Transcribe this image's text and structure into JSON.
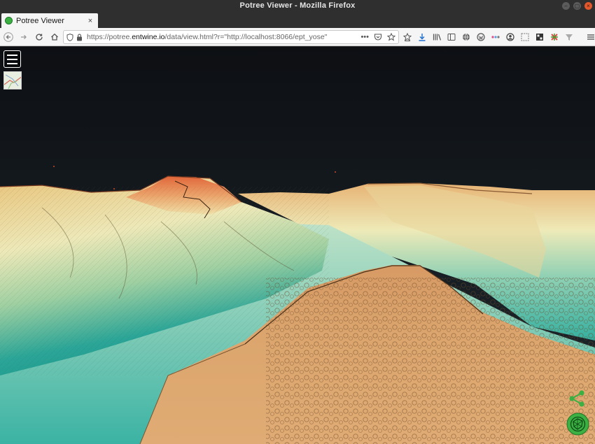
{
  "window": {
    "title": "Potree Viewer - Mozilla Firefox"
  },
  "tabs": [
    {
      "label": "Potree Viewer",
      "close_glyph": "×"
    }
  ],
  "new_tab_glyph": "+",
  "navigation": {
    "url_prefix": "https://potree.",
    "url_domain": "entwine.io",
    "url_suffix": "/data/view.html?r=\"http://localhost:8066/ept_yose\"",
    "url_more_glyph": "•••"
  },
  "icons": {
    "back": "back-arrow-icon",
    "forward": "forward-arrow-icon",
    "reload": "reload-icon",
    "home": "home-icon",
    "shield": "tracking-shield-icon",
    "lock": "lock-icon",
    "pocket": "pocket-icon",
    "bookmark": "bookmark-star-icon",
    "downloads": "download-arrow-icon",
    "library": "library-icon",
    "sidebar": "sidebar-icon",
    "menu": "hamburger-menu-icon",
    "share": "share-icon",
    "potree": "potree-logo-icon"
  },
  "colors": {
    "sky_top": "#0d0f13",
    "sky_bottom": "#1f2a30",
    "terrain_low": "#1e9b8f",
    "terrain_mid": "#e8e6b0",
    "terrain_high": "#e06a3a",
    "terrain_valley": "#d9a066",
    "accent_green": "#3cb043"
  }
}
